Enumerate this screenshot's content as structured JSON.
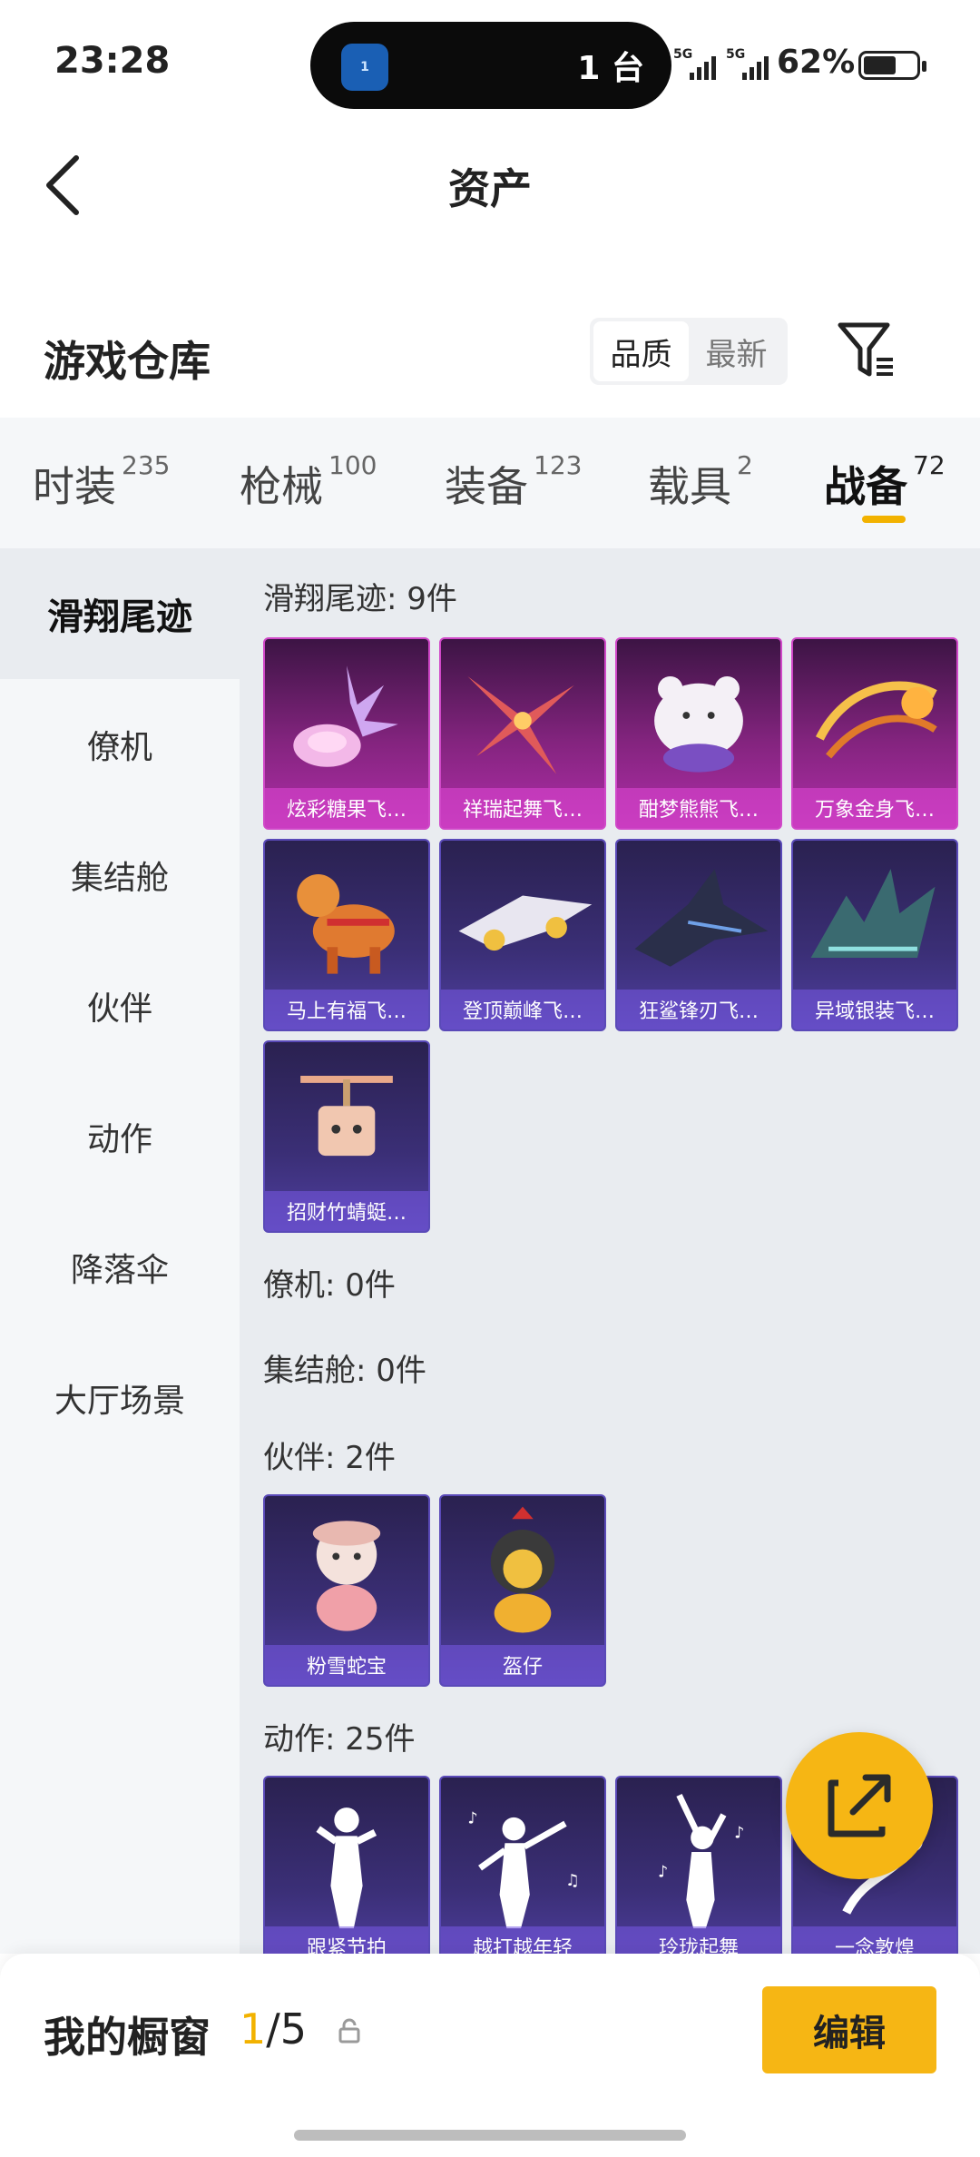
{
  "status_bar": {
    "time": "23:28",
    "island_app": "1",
    "island_text": "1 台",
    "net1": "5G",
    "net2": "5G",
    "battery": "62%",
    "battery_level": 0.62
  },
  "nav": {
    "title": "资产"
  },
  "header": {
    "title": "游戏仓库",
    "sort_options": [
      "品质",
      "最新"
    ],
    "sort_selected": "品质"
  },
  "tabs": [
    {
      "label": "时装",
      "count": "235"
    },
    {
      "label": "枪械",
      "count": "100"
    },
    {
      "label": "装备",
      "count": "123"
    },
    {
      "label": "载具",
      "count": "2"
    },
    {
      "label": "战备",
      "count": "72",
      "active": true
    }
  ],
  "sidebar": {
    "items": [
      "滑翔尾迹",
      "僚机",
      "集结舱",
      "伙伴",
      "动作",
      "降落伞",
      "大厅场景"
    ],
    "active": "滑翔尾迹"
  },
  "sections": {
    "glide": {
      "title": "滑翔尾迹: 9件",
      "items": [
        {
          "name": "炫彩糖果飞…",
          "tier": "pink"
        },
        {
          "name": "祥瑞起舞飞…",
          "tier": "pink"
        },
        {
          "name": "酣梦熊熊飞…",
          "tier": "pink"
        },
        {
          "name": "万象金身飞…",
          "tier": "pink"
        },
        {
          "name": "马上有福飞…",
          "tier": "purple"
        },
        {
          "name": "登顶巅峰飞…",
          "tier": "purple"
        },
        {
          "name": "狂鲨锋刃飞…",
          "tier": "purple"
        },
        {
          "name": "异域银装飞…",
          "tier": "purple"
        },
        {
          "name": "招财竹蜻蜓…",
          "tier": "purple"
        }
      ]
    },
    "wingman": {
      "title": "僚机: 0件"
    },
    "pod": {
      "title": "集结舱: 0件"
    },
    "companion": {
      "title": "伙伴: 2件",
      "items": [
        {
          "name": "粉雪蛇宝",
          "tier": "purple"
        },
        {
          "name": "盔仔",
          "tier": "purple"
        }
      ]
    },
    "emote": {
      "title": "动作: 25件",
      "items": [
        {
          "name": "跟紧节拍",
          "tier": "purple"
        },
        {
          "name": "越打越年轻",
          "tier": "purple"
        },
        {
          "name": "玲珑起舞",
          "tier": "purple"
        },
        {
          "name": "一念敦煌",
          "tier": "purple"
        }
      ]
    }
  },
  "bottom": {
    "label": "我的橱窗",
    "current": "1",
    "total": "/5",
    "edit": "编辑"
  },
  "colors": {
    "accent": "#f6b614",
    "purple_card": "#3b2f77",
    "pink_card": "#84247f"
  }
}
